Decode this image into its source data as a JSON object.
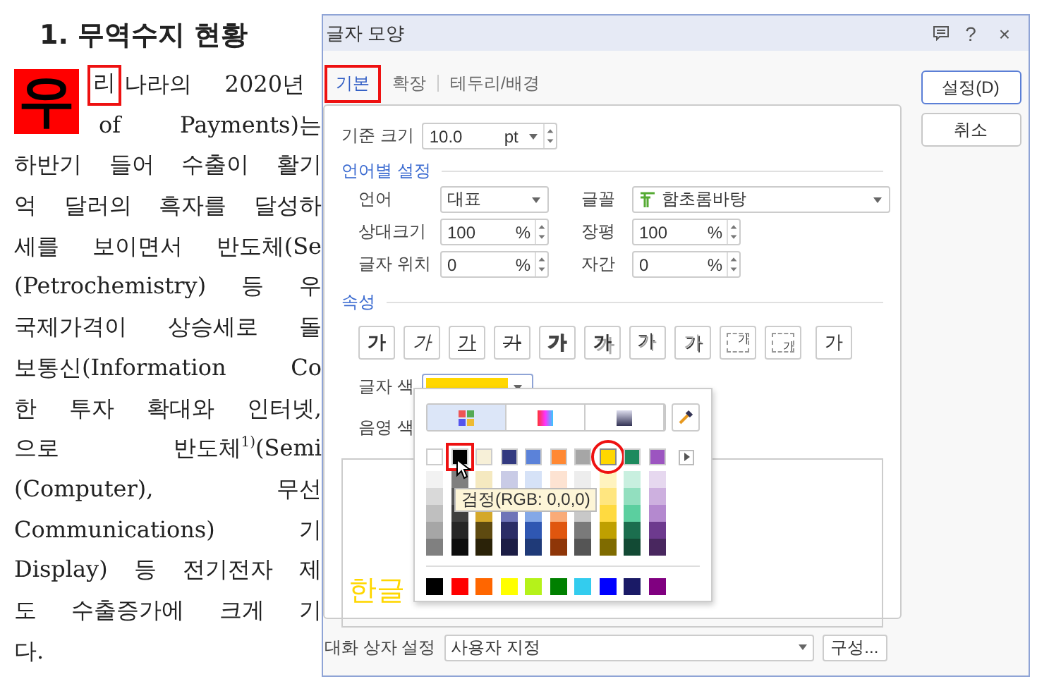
{
  "document": {
    "heading": "1. 무역수지 현황",
    "first_line": {
      "drop_cap": "우",
      "marked": "리",
      "text": "나라의 2020년"
    },
    "lines": [
      "of Payments)는",
      "하반기 들어 수출이 활기",
      "억 달러의 흑자를 달성하",
      "세를 보이면서 반도체(Se",
      "(Petrochemistry) 등 우",
      "국제가격이 상승세로 돌",
      "보통신(Information Co",
      "한 투자 확대와 인터넷,",
      "으로 반도체$^{1)}$(Semi",
      "(Computer), 무선",
      "Communications) 기",
      "Display) 등 전기전자 제",
      "도 수출증가에 크게 기",
      "다."
    ]
  },
  "dialog": {
    "title": "글자 모양",
    "title_buttons": [
      "?",
      "×"
    ],
    "tabs": [
      {
        "label": "기본",
        "selected": true,
        "annotated": true
      },
      {
        "label": "확장",
        "selected": false,
        "annotated": false
      },
      {
        "label": "테두리/배경",
        "selected": false,
        "annotated": false
      }
    ],
    "base_size": {
      "label": "기준 크기",
      "value": "10.0",
      "unit": "pt"
    },
    "language_section": "언어별 설정",
    "fields": [
      {
        "label": "언어",
        "value": "대표",
        "kind": "dropdown"
      },
      {
        "label": "글꼴",
        "value": "함초롬바탕",
        "kind": "font"
      },
      {
        "label": "상대크기",
        "value": "100",
        "unit": "%",
        "kind": "spin"
      },
      {
        "label": "장평",
        "value": "100",
        "unit": "%",
        "kind": "spin"
      },
      {
        "label": "글자 위치",
        "value": "0",
        "unit": "%",
        "kind": "spin"
      },
      {
        "label": "자간",
        "value": "0",
        "unit": "%",
        "kind": "spin"
      }
    ],
    "attributes_section": "속성",
    "attributes": [
      {
        "label": "가",
        "kind": "bold"
      },
      {
        "label": "가",
        "kind": "italic"
      },
      {
        "label": "가",
        "kind": "underline"
      },
      {
        "label": "가",
        "kind": "strike"
      },
      {
        "label": "가",
        "kind": "outline"
      },
      {
        "label": "가",
        "kind": "shadow"
      },
      {
        "label": "가",
        "kind": "emboss"
      },
      {
        "label": "가",
        "kind": "engrave"
      },
      {
        "label": "가",
        "kind": "superscript"
      },
      {
        "label": "가",
        "kind": "subscript"
      },
      {
        "label": "가",
        "kind": "normal"
      }
    ],
    "text_color": {
      "label": "글자 색",
      "color": "#ffd700"
    },
    "shade_color": {
      "label": "음영 색"
    },
    "preview": {
      "text": "한글",
      "color": "#ffd700"
    },
    "palette": {
      "tabs": [
        {
          "kind": "grid",
          "selected": true
        },
        {
          "kind": "spectrum",
          "selected": false
        },
        {
          "kind": "image",
          "selected": false
        }
      ],
      "theme": [
        {
          "color": "#ffffff",
          "selected": false,
          "boxed": false,
          "circled": false
        },
        {
          "color": "#000000",
          "selected": false,
          "boxed": true,
          "circled": false
        },
        {
          "color": "#f7f0d8",
          "selected": false,
          "boxed": false,
          "circled": false
        },
        {
          "color": "#333a80",
          "selected": false,
          "boxed": false,
          "circled": false
        },
        {
          "color": "#5b82d9",
          "selected": false,
          "boxed": false,
          "circled": false
        },
        {
          "color": "#ff8833",
          "selected": false,
          "boxed": false,
          "circled": false
        },
        {
          "color": "#a6a6a6",
          "selected": false,
          "boxed": false,
          "circled": false
        },
        {
          "color": "#ffd700",
          "selected": true,
          "boxed": false,
          "circled": true
        },
        {
          "color": "#1e8a5e",
          "selected": false,
          "boxed": false,
          "circled": false
        },
        {
          "color": "#9c55c0",
          "selected": false,
          "boxed": false,
          "circled": false
        }
      ],
      "shades": [
        {
          "top": [
            {
              "color": "#f2f2f2"
            },
            {
              "color": "#d9d9d9"
            }
          ],
          "bottom": [
            {
              "color": "#bfbfbf"
            },
            {
              "color": "#a6a6a6"
            },
            {
              "color": "#808080"
            }
          ]
        },
        {
          "top": [
            {
              "color": "#7f7f7f"
            },
            {
              "color": "#595959"
            }
          ],
          "bottom": [
            {
              "color": "#3f3f3f"
            },
            {
              "color": "#262626"
            },
            {
              "color": "#0d0d0d"
            }
          ]
        },
        {
          "top": [
            {
              "color": "#f5e9c0"
            }
          ],
          "bottom": [
            {
              "color": "#d4a82a"
            },
            {
              "color": "#5e4a10"
            },
            {
              "color": "#2a2208"
            }
          ]
        },
        {
          "top": [
            {
              "color": "#c9cbe6"
            }
          ],
          "bottom": [
            {
              "color": "#6f74b8"
            },
            {
              "color": "#2b2d66"
            },
            {
              "color": "#1c1d45"
            }
          ]
        },
        {
          "top": [
            {
              "color": "#d6e2f7"
            }
          ],
          "bottom": [
            {
              "color": "#84a8e7"
            },
            {
              "color": "#2f57b2"
            },
            {
              "color": "#1f3a78"
            }
          ]
        },
        {
          "top": [
            {
              "color": "#fde3d2"
            }
          ],
          "bottom": [
            {
              "color": "#f9ab78"
            },
            {
              "color": "#e0560e"
            },
            {
              "color": "#8f3608"
            }
          ]
        },
        {
          "top": [
            {
              "color": "#ededed"
            }
          ],
          "bottom": [
            {
              "color": "#c8c8c8"
            },
            {
              "color": "#7a7a7a"
            },
            {
              "color": "#555555"
            }
          ]
        },
        {
          "top": [
            {
              "color": "#fff3bf"
            },
            {
              "color": "#ffe680"
            }
          ],
          "bottom": [
            {
              "color": "#ffda40"
            },
            {
              "color": "#bfa000"
            },
            {
              "color": "#7f6b00"
            }
          ]
        },
        {
          "top": [
            {
              "color": "#c8efdf"
            },
            {
              "color": "#92dfbf"
            }
          ],
          "bottom": [
            {
              "color": "#5bcf9f"
            },
            {
              "color": "#1b6e4e"
            },
            {
              "color": "#124a34"
            }
          ]
        },
        {
          "top": [
            {
              "color": "#e6d8ef"
            },
            {
              "color": "#cdb0df"
            }
          ],
          "bottom": [
            {
              "color": "#b489cf"
            },
            {
              "color": "#6d3a8e"
            },
            {
              "color": "#49275f"
            }
          ]
        }
      ],
      "standard": [
        {
          "color": "#000000"
        },
        {
          "color": "#ff0000"
        },
        {
          "color": "#ff6600"
        },
        {
          "color": "#ffff00"
        },
        {
          "color": "#b5f21a"
        },
        {
          "color": "#008000"
        },
        {
          "color": "#33ccee"
        },
        {
          "color": "#0000ff"
        },
        {
          "color": "#1a1a66"
        },
        {
          "color": "#800080"
        }
      ],
      "tooltip": "검정(RGB: 0,0,0)"
    },
    "dialog_setting": {
      "label": "대화 상자 설정",
      "value": "사용자 지정",
      "button": "구성..."
    },
    "buttons": [
      {
        "label": "설정(D)",
        "kind": "primary"
      },
      {
        "label": "취소",
        "kind": "normal"
      }
    ]
  }
}
